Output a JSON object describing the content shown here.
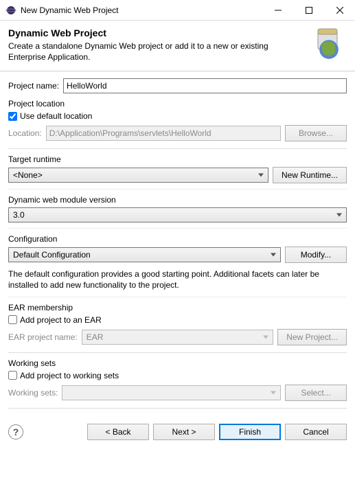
{
  "window": {
    "title": "New Dynamic Web Project"
  },
  "banner": {
    "title": "Dynamic Web Project",
    "desc": "Create a standalone Dynamic Web project or add it to a new or existing Enterprise Application."
  },
  "projectName": {
    "label": "Project name:",
    "value": "HelloWorld"
  },
  "projectLocation": {
    "group": "Project location",
    "useDefaultLabel": "Use default location",
    "useDefaultChecked": true,
    "locationLabel": "Location:",
    "locationValue": "D:\\Application\\Programs\\servlets\\HelloWorld",
    "browse": "Browse..."
  },
  "targetRuntime": {
    "group": "Target runtime",
    "value": "<None>",
    "newRuntime": "New Runtime..."
  },
  "moduleVersion": {
    "group": "Dynamic web module version",
    "value": "3.0"
  },
  "configuration": {
    "group": "Configuration",
    "value": "Default Configuration",
    "modify": "Modify...",
    "desc": "The default configuration provides a good starting point. Additional facets can later be installed to add new functionality to the project."
  },
  "ear": {
    "group": "EAR membership",
    "addLabel": "Add project to an EAR",
    "addChecked": false,
    "nameLabel": "EAR project name:",
    "nameValue": "EAR",
    "newProject": "New Project..."
  },
  "workingSets": {
    "group": "Working sets",
    "addLabel": "Add project to working sets",
    "addChecked": false,
    "setsLabel": "Working sets:",
    "select": "Select..."
  },
  "buttons": {
    "back": "< Back",
    "next": "Next >",
    "finish": "Finish",
    "cancel": "Cancel"
  }
}
